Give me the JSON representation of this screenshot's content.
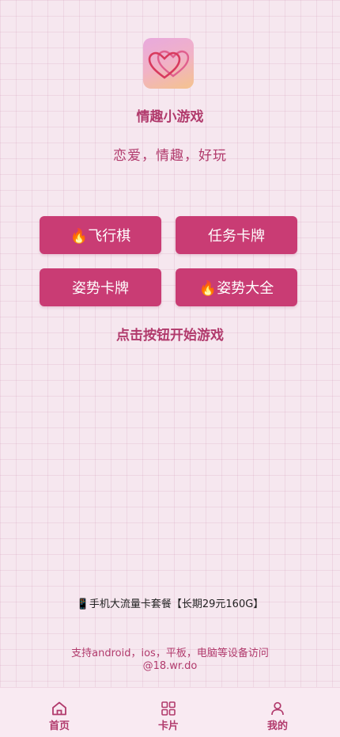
{
  "app": {
    "logo_icon": "double-heart-icon",
    "title": "情趣小游戏",
    "slogan": "恋爱，情趣，好玩"
  },
  "games": [
    {
      "icon": "fire-icon",
      "label": "🔥飞行棋"
    },
    {
      "label": "任务卡牌"
    },
    {
      "label": "姿势卡牌"
    },
    {
      "icon": "fire-icon",
      "label": "🔥姿势大全"
    }
  ],
  "hint": "点击按钮开始游戏",
  "promo": {
    "icon": "phone-icon",
    "text": "📱手机大流量卡套餐【长期29元160G】"
  },
  "footer": {
    "support": "支持android，ios，平板，电脑等设备访问",
    "domain": "@18.wr.do"
  },
  "tabbar": [
    {
      "icon": "home-icon",
      "label": "首页"
    },
    {
      "icon": "grid-icon",
      "label": "卡片"
    },
    {
      "icon": "user-icon",
      "label": "我的"
    }
  ],
  "colors": {
    "accent": "#c93c74",
    "text_accent": "#b13a6c",
    "background": "#f6e7ef"
  }
}
